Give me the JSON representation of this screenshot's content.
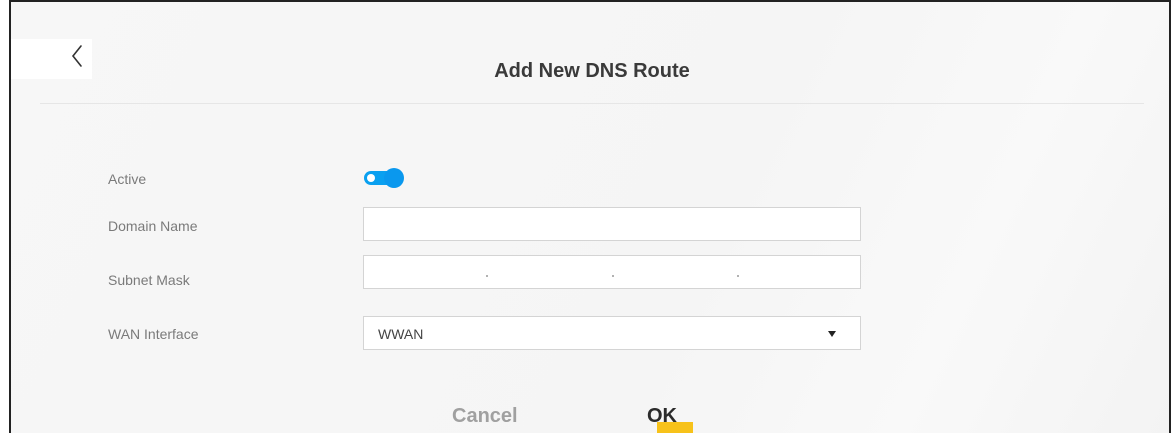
{
  "dialog": {
    "title": "Add New DNS Route"
  },
  "form": {
    "active_label": "Active",
    "active_value": true,
    "domain_name_label": "Domain Name",
    "domain_name_value": "",
    "subnet_mask_label": "Subnet Mask",
    "subnet_mask_value": "",
    "wan_interface_label": "WAN Interface",
    "wan_interface_value": "WWAN"
  },
  "actions": {
    "cancel_label": "Cancel",
    "ok_label": "OK"
  },
  "colors": {
    "toggle_on": "#0a98ee",
    "ok_highlight": "#f7c21a"
  }
}
